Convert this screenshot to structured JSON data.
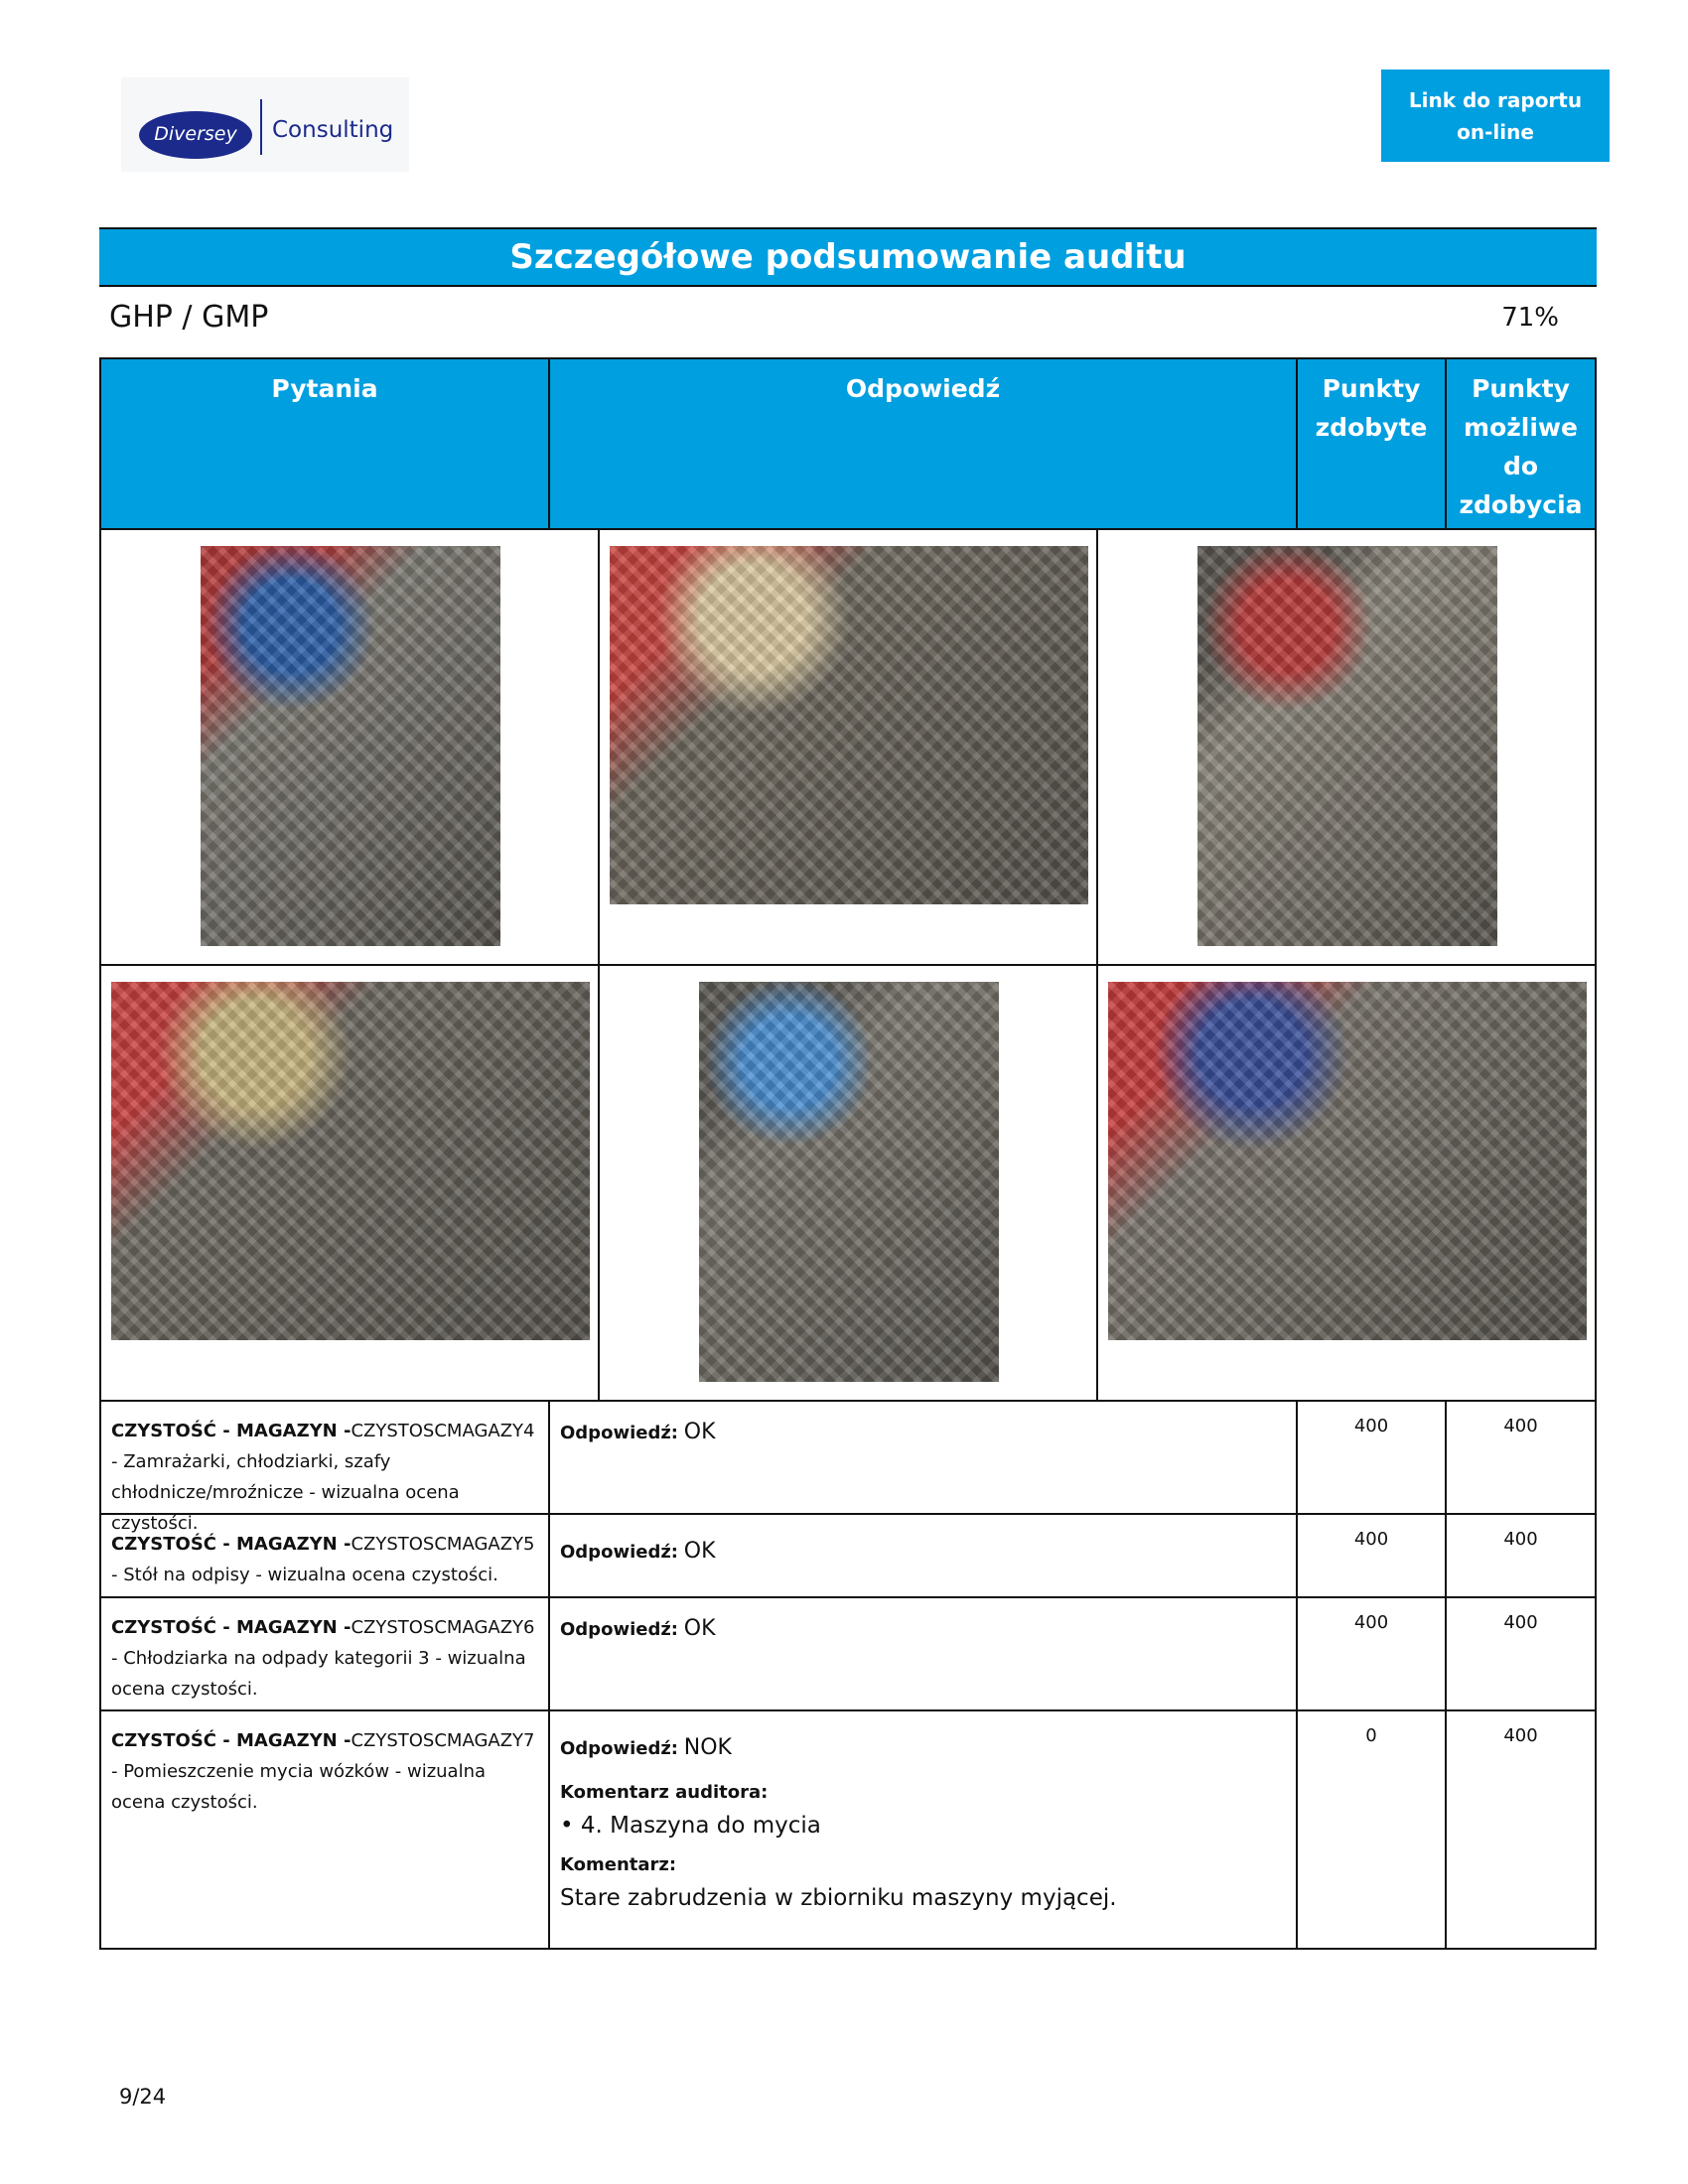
{
  "header": {
    "logo_brand": "Diversey",
    "logo_division": "Consulting",
    "link_button": "Link do raportu on-line"
  },
  "title": "Szczegółowe podsumowanie auditu",
  "section": {
    "name": "GHP / GMP",
    "score": "71%"
  },
  "table": {
    "columns": [
      "Pytania",
      "Odpowiedź",
      "Punkty zdobyte",
      "Punkty możliwe do zdobycia"
    ],
    "rows": [
      {
        "category": "CZYSTOŚĆ - MAGAZYN -",
        "code": "CZYSTOSCMAGAZY4 - Zamrażarki, chłodziarki, szafy chłodnicze/mroźnicze - wizualna ocena czystości.",
        "answer_label": "Odpowiedź:",
        "answer": "OK",
        "points_earned": "400",
        "points_possible": "400"
      },
      {
        "category": "CZYSTOŚĆ - MAGAZYN -",
        "code": "CZYSTOSCMAGAZY5 - Stół na odpisy - wizualna ocena czystości.",
        "answer_label": "Odpowiedź:",
        "answer": "OK",
        "points_earned": "400",
        "points_possible": "400"
      },
      {
        "category": "CZYSTOŚĆ - MAGAZYN -",
        "code": "CZYSTOSCMAGAZY6 - Chłodziarka na odpady kategorii 3 - wizualna ocena czystości.",
        "answer_label": "Odpowiedź:",
        "answer": "OK",
        "points_earned": "400",
        "points_possible": "400"
      },
      {
        "category": "CZYSTOŚĆ - MAGAZYN -",
        "code": "CZYSTOSCMAGAZY7 - Pomieszczenie mycia wózków - wizualna ocena czystości.",
        "answer_label": "Odpowiedź:",
        "answer": "NOK",
        "auditor_comment_label": "Komentarz auditora:",
        "auditor_comment": "• 4. Maszyna do mycia",
        "comment_label": "Komentarz:",
        "comment": "Stare zabrudzenia w zbiorniku maszyny myjącej.",
        "points_earned": "0",
        "points_possible": "400"
      }
    ]
  },
  "photos": [
    {
      "desc": "floor-photo-1",
      "colors": [
        "#7d7a73",
        "#b43a3a",
        "#2b5fa8"
      ]
    },
    {
      "desc": "floor-photo-2",
      "colors": [
        "#6f6a60",
        "#c8443f",
        "#d9c8a0"
      ]
    },
    {
      "desc": "floor-photo-3",
      "colors": [
        "#8c877c",
        "#5a5650",
        "#b83b3b"
      ]
    },
    {
      "desc": "floor-photo-4",
      "colors": [
        "#6e6a62",
        "#c84040",
        "#c7b47e"
      ]
    },
    {
      "desc": "floor-photo-5",
      "colors": [
        "#7b776f",
        "#5d5a55",
        "#4a8ed0"
      ]
    },
    {
      "desc": "floor-photo-6",
      "colors": [
        "#7a756d",
        "#c53c3c",
        "#3b4f9a"
      ]
    }
  ],
  "page_number": "9/24"
}
